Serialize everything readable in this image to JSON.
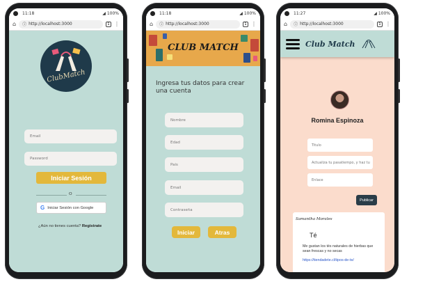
{
  "phones": [
    {
      "statusbar": {
        "time": "11:18",
        "battery": "100%"
      },
      "urlbar": {
        "url": "http://localhost:3000"
      },
      "logo": {
        "brand": "ClubMatch"
      },
      "email": {
        "placeholder": "Email"
      },
      "password": {
        "placeholder": "Password"
      },
      "login_button": "Iniciar Sesión",
      "divider": "O",
      "google_button": "Iniciar Sesión con Google",
      "register_prompt": "¿Aún no tienes cuenta?",
      "register_link": "Registrate"
    },
    {
      "statusbar": {
        "time": "11:18",
        "battery": "100%"
      },
      "urlbar": {
        "url": "http://localhost:3000"
      },
      "banner_title": "CLUB MATCH",
      "heading": "Ingresa tus datos para crear una cuenta",
      "fields": [
        "Nombre",
        "Edad",
        "Pais",
        "Email",
        "Contraseña"
      ],
      "start_button": "Iniciar",
      "back_button": "Atras"
    },
    {
      "statusbar": {
        "time": "11:27",
        "battery": "100%"
      },
      "urlbar": {
        "url": "http://localhost:3000"
      },
      "brand": "Club Match",
      "user_name": "Romina Espinoza",
      "form": {
        "title_placeholder": "Titulo",
        "description_placeholder": "Actualiza tu pasatiempo, y haz tu",
        "link_placeholder": "Enlace"
      },
      "publish_button": "Publicar",
      "post": {
        "author": "Samantha Morales",
        "title": "Té",
        "body": "Me gustan los tés naturales de hierbas que sean frescas y no secas",
        "link": "https://tiendadete.cl/tipos-de-te/"
      }
    }
  ],
  "colors": {
    "mint": "#bfdcd6",
    "peach": "#fbdccc",
    "yellow": "#e3b83b",
    "navy": "#1f3a4a",
    "dark_button": "#2a3d48"
  }
}
